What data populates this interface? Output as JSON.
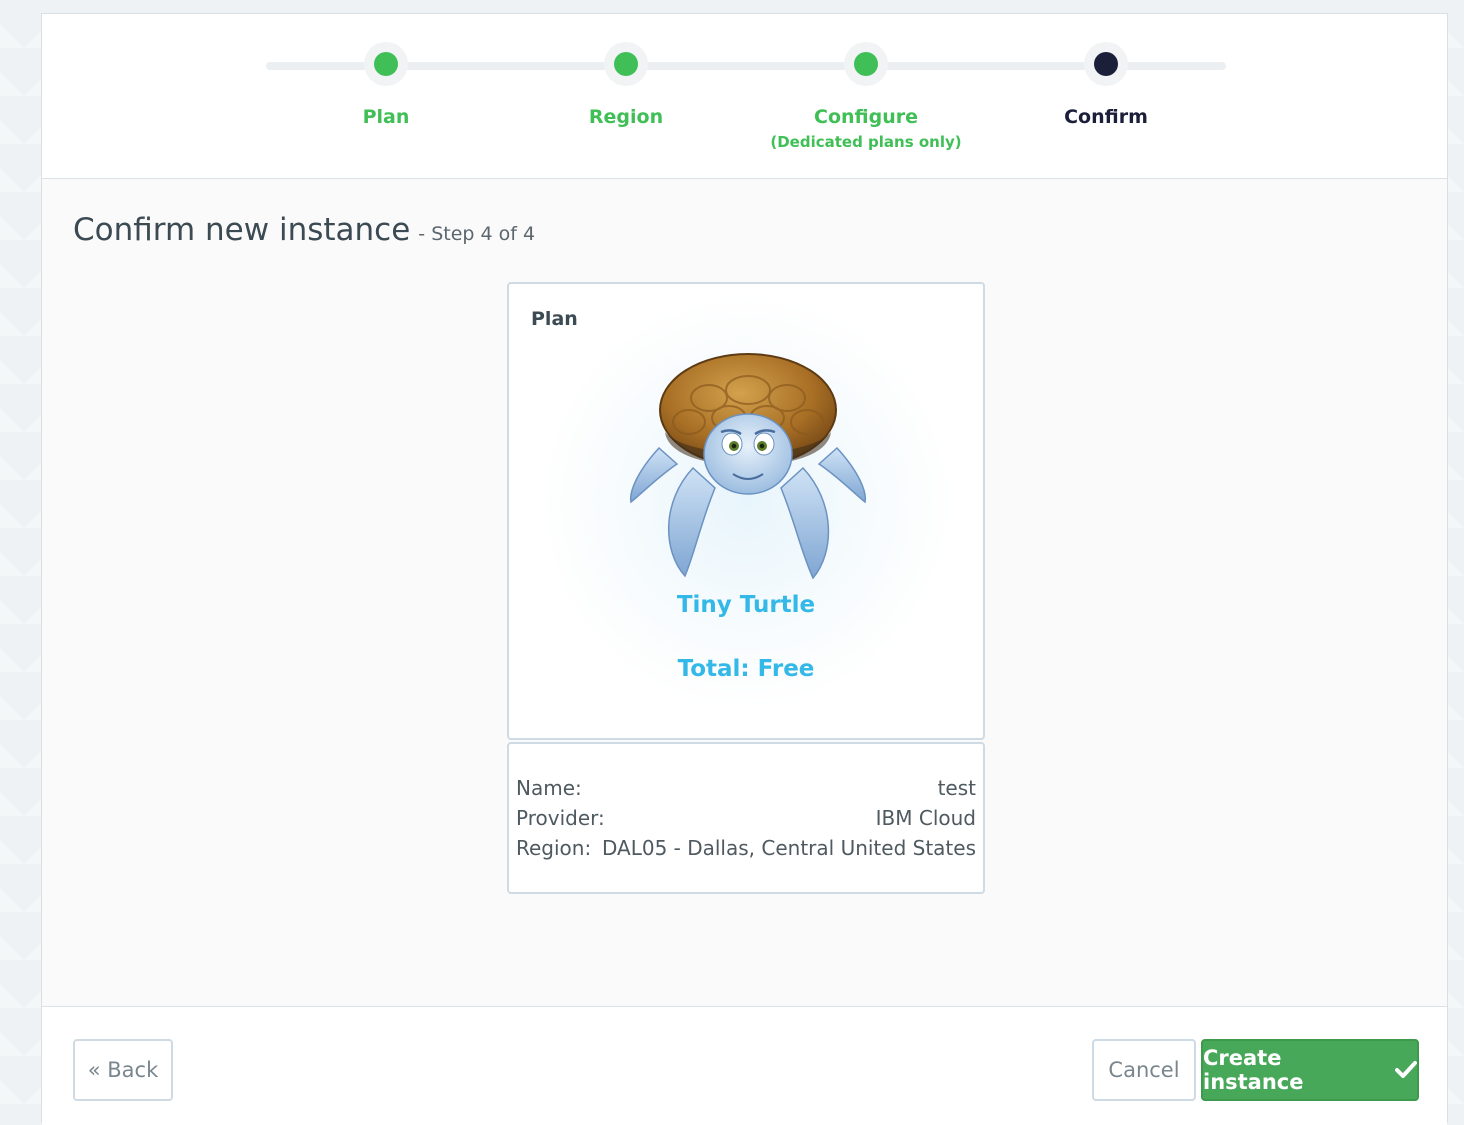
{
  "stepper": {
    "steps": [
      {
        "label": "Plan",
        "sublabel": "",
        "state": "complete",
        "color": "#3fbf55"
      },
      {
        "label": "Region",
        "sublabel": "",
        "state": "complete",
        "color": "#3fbf55"
      },
      {
        "label": "Configure",
        "sublabel": "(Dedicated plans only)",
        "state": "complete",
        "color": "#3fbf55"
      },
      {
        "label": "Confirm",
        "sublabel": "",
        "state": "current",
        "color": "#1c1f3a"
      }
    ]
  },
  "page": {
    "title": "Confirm new instance",
    "subtitle": "- Step 4 of 4"
  },
  "plan_card": {
    "title": "Plan",
    "plan_name": "Tiny Turtle",
    "total": "Total: Free",
    "illustration": "turtle-mascot"
  },
  "details": [
    {
      "label": "Name:",
      "value": "test"
    },
    {
      "label": "Provider:",
      "value": "IBM Cloud"
    },
    {
      "label": "Region:",
      "value": "DAL05 - Dallas, Central United States"
    }
  ],
  "footer": {
    "back_label": "« Back",
    "cancel_label": "Cancel",
    "create_label": "Create instance",
    "create_icon": "check-icon"
  },
  "colors": {
    "step_complete": "#3fbf55",
    "step_current": "#1c1f3a",
    "accent_blue": "#33b8e8",
    "create_button": "#48a85a"
  }
}
